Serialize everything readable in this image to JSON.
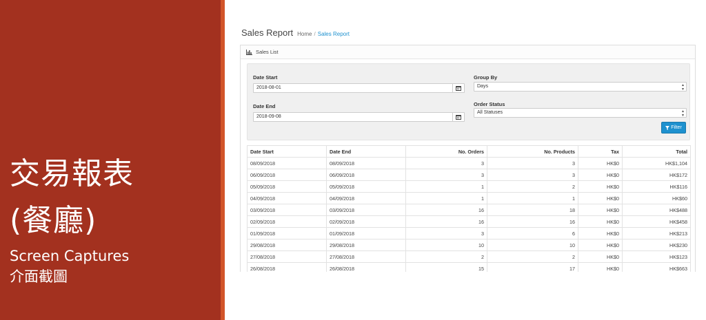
{
  "side_panel": {
    "title_line1": "交易報表",
    "title_line2": "(餐廳)",
    "subtitle_line1": "Screen Captures",
    "subtitle_line2": "介面截圖",
    "background_color": "#a3311f",
    "stripe_color": "#d2552a"
  },
  "header": {
    "title": "Sales Report",
    "breadcrumb": {
      "home": "Home",
      "separator": "/",
      "current": "Sales Report"
    }
  },
  "panel": {
    "heading_icon": "bar-chart-icon",
    "heading": "Sales List"
  },
  "filters": {
    "date_start_label": "Date Start",
    "date_start_value": "2018-08-01",
    "date_end_label": "Date End",
    "date_end_value": "2018-09-08",
    "group_by_label": "Group By",
    "group_by_value": "Days",
    "order_status_label": "Order Status",
    "order_status_value": "All Statuses",
    "calendar_icon": "calendar-icon",
    "filter_icon": "funnel-icon",
    "filter_button": "Filter",
    "accent_color": "#1e91cf"
  },
  "table": {
    "headers": [
      "Date Start",
      "Date End",
      "No. Orders",
      "No. Products",
      "Tax",
      "Total"
    ],
    "rows": [
      [
        "08/09/2018",
        "08/09/2018",
        "3",
        "3",
        "HK$0",
        "HK$1,104"
      ],
      [
        "06/09/2018",
        "06/09/2018",
        "3",
        "3",
        "HK$0",
        "HK$172"
      ],
      [
        "05/09/2018",
        "05/09/2018",
        "1",
        "2",
        "HK$0",
        "HK$116"
      ],
      [
        "04/09/2018",
        "04/09/2018",
        "1",
        "1",
        "HK$0",
        "HK$60"
      ],
      [
        "03/09/2018",
        "03/09/2018",
        "16",
        "18",
        "HK$0",
        "HK$488"
      ],
      [
        "02/09/2018",
        "02/09/2018",
        "16",
        "16",
        "HK$0",
        "HK$458"
      ],
      [
        "01/09/2018",
        "01/09/2018",
        "3",
        "6",
        "HK$0",
        "HK$213"
      ],
      [
        "29/08/2018",
        "29/08/2018",
        "10",
        "10",
        "HK$0",
        "HK$230"
      ],
      [
        "27/08/2018",
        "27/08/2018",
        "2",
        "2",
        "HK$0",
        "HK$123"
      ],
      [
        "26/08/2018",
        "26/08/2018",
        "15",
        "17",
        "HK$0",
        "HK$663"
      ]
    ]
  }
}
